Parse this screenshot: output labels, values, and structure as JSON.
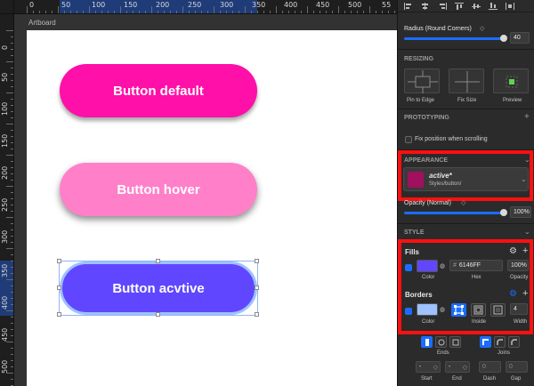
{
  "rulers": {
    "top": [
      "0",
      "50",
      "100",
      "150",
      "200",
      "250",
      "300",
      "350",
      "400",
      "450",
      "500",
      "55"
    ],
    "left": [
      "0",
      "50",
      "100",
      "150",
      "200",
      "250",
      "300",
      "350",
      "400",
      "450",
      "500"
    ]
  },
  "canvas": {
    "artboard_label": "Artboard",
    "buttons": {
      "default_label": "Button default",
      "default_color": "#FF10A8",
      "hover_label": "Button hover",
      "hover_color": "#FF80C9",
      "active_label": "Button acvtive",
      "active_color": "#6146FF"
    }
  },
  "inspector": {
    "radius": {
      "label": "Radius (Round Corners)",
      "value": "40"
    },
    "resizing": {
      "title": "RESIZING",
      "options": [
        "Pin to Edge",
        "Fix Size",
        "Preview"
      ]
    },
    "prototyping": {
      "title": "PROTOTYPING",
      "fix_position_label": "Fix position when scrolling"
    },
    "appearance": {
      "title": "APPEARANCE",
      "style_name": "active*",
      "style_path": "Styles/button/",
      "swatch_color": "#A0105F"
    },
    "opacity": {
      "label": "Opacity (Normal)",
      "value": "100%"
    },
    "style": {
      "title": "STYLE"
    },
    "fills": {
      "title": "Fills",
      "hex_prefix": "#",
      "hex": "6146FF",
      "opacity": "100%",
      "sub_labels": [
        "Color",
        "Hex",
        "Opacity"
      ],
      "color": "#6146FF"
    },
    "borders": {
      "title": "Borders",
      "width": "4",
      "sub_labels": [
        "Color",
        "Inside",
        "Width"
      ],
      "color": "#9DC2FF"
    },
    "ends_label": "Ends",
    "joins_label": "Joins",
    "dash_row": {
      "values": [
        "-",
        "-",
        "0",
        "0"
      ],
      "labels": [
        "Start",
        "End",
        "Dash",
        "Gap"
      ]
    },
    "highlight_color": "#FF1010",
    "accent_color": "#1A6DFF"
  }
}
